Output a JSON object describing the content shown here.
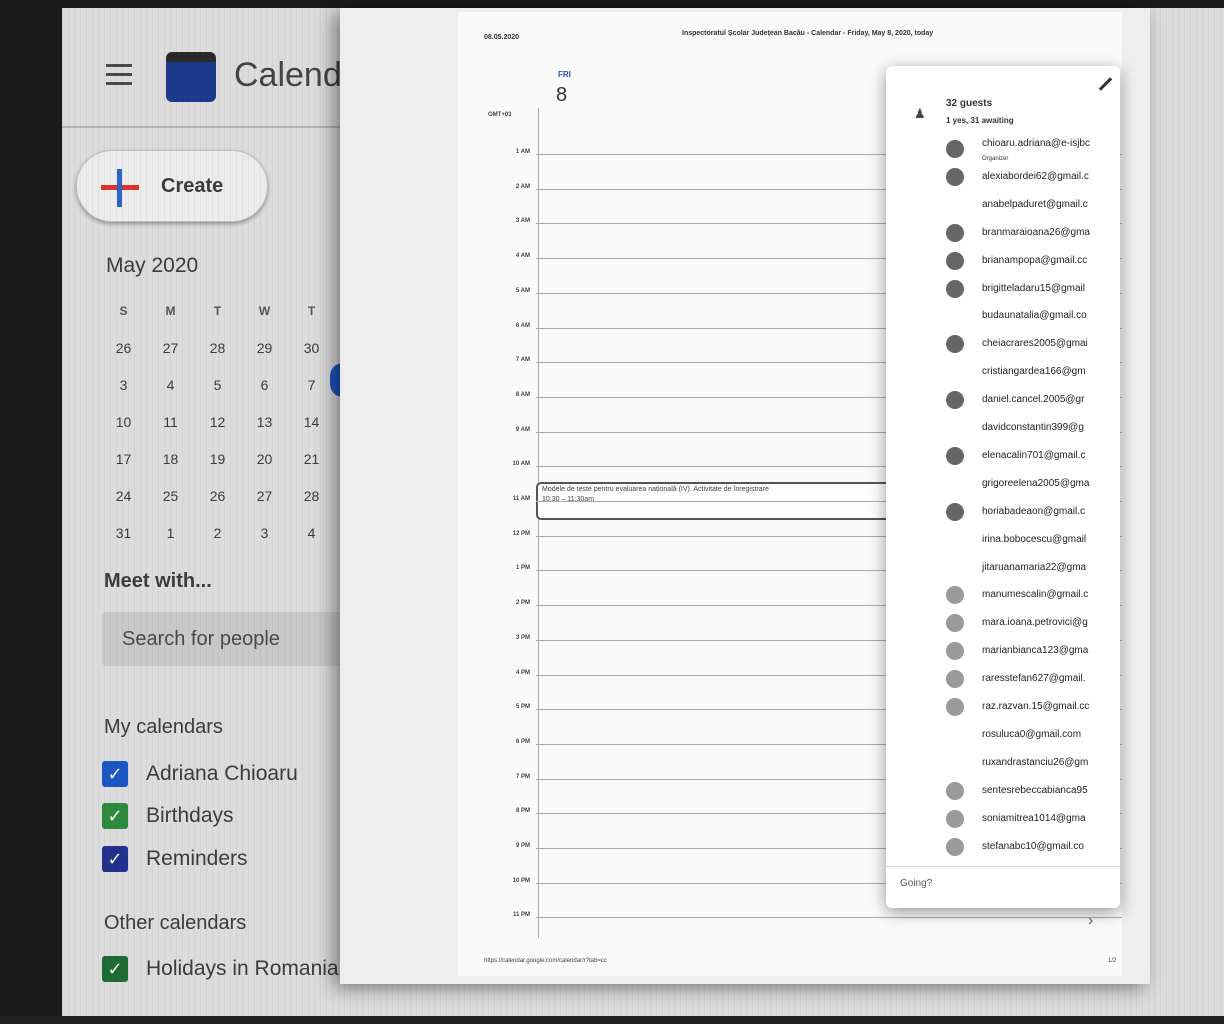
{
  "sidebar": {
    "app_title": "Calend",
    "create_label": "Create",
    "month_title": "May 2020",
    "weekday_headers": [
      "S",
      "M",
      "T",
      "W",
      "T"
    ],
    "weeks": [
      [
        "26",
        "27",
        "28",
        "29",
        "30"
      ],
      [
        "3",
        "4",
        "5",
        "6",
        "7"
      ],
      [
        "10",
        "11",
        "12",
        "13",
        "14"
      ],
      [
        "17",
        "18",
        "19",
        "20",
        "21"
      ],
      [
        "24",
        "25",
        "26",
        "27",
        "28"
      ],
      [
        "31",
        "1",
        "2",
        "3",
        "4"
      ]
    ],
    "meet_title": "Meet with...",
    "search_placeholder": "Search for people",
    "my_calendars_title": "My calendars",
    "my_calendars": [
      {
        "label": "Adriana Chioaru",
        "color": "#1a56c4",
        "checked": true
      },
      {
        "label": "Birthdays",
        "color": "#2e8b3e",
        "checked": true
      },
      {
        "label": "Reminders",
        "color": "#23318f",
        "checked": true
      }
    ],
    "other_calendars_title": "Other calendars",
    "other_calendars": [
      {
        "label": "Holidays in Romania",
        "color": "#1f6b34",
        "checked": true
      }
    ],
    "today_color": "#1a56c4"
  },
  "print_preview": {
    "date": "08.05.2020",
    "header": "Inspectoratul Școlar Județean Bacău - Calendar - Friday, May 8, 2020, today",
    "day_abbrev": "FRI",
    "day_number": "8",
    "timezone": "GMT+03",
    "hours": [
      "1 AM",
      "2 AM",
      "3 AM",
      "4 AM",
      "5 AM",
      "6 AM",
      "7 AM",
      "8 AM",
      "9 AM",
      "10 AM",
      "11 AM",
      "12 PM",
      "1 PM",
      "2 PM",
      "3 PM",
      "4 PM",
      "5 PM",
      "6 PM",
      "7 PM",
      "8 PM",
      "9 PM",
      "10 PM",
      "11 PM"
    ],
    "event": {
      "title": "Modele de teste pentru evaluarea națională (IV). Activitate de înregistrare",
      "time": "10:30 – 11:30am"
    },
    "url": "https://calendar.google.com/calendar/r?tab=cc",
    "page": "1/2"
  },
  "popup": {
    "guest_count": "32 guests",
    "guest_status": "1 yes, 31 awaiting",
    "organizer_role": "Organizer",
    "going_label": "Going?",
    "guests": [
      {
        "email": "chioaru.adriana@e-isjbc",
        "avatar": "dark"
      },
      {
        "email": "alexiabordei62@gmail.c",
        "avatar": "dark"
      },
      {
        "email": "anabelpaduret@gmail.c",
        "avatar": "none"
      },
      {
        "email": "branmaraioana26@gma",
        "avatar": "dark"
      },
      {
        "email": "brianampopa@gmail.cc",
        "avatar": "dark"
      },
      {
        "email": "brigitteladaru15@gmail",
        "avatar": "dark"
      },
      {
        "email": "budaunatalia@gmail.co",
        "avatar": "none"
      },
      {
        "email": "cheiacrares2005@gmai",
        "avatar": "dark"
      },
      {
        "email": "cristiangardea166@gm",
        "avatar": "none"
      },
      {
        "email": "daniel.cancel.2005@gr",
        "avatar": "dark"
      },
      {
        "email": "davidconstantin399@g",
        "avatar": "none"
      },
      {
        "email": "elenacalin701@gmail.c",
        "avatar": "dark"
      },
      {
        "email": "grigoreelena2005@gma",
        "avatar": "none"
      },
      {
        "email": "horiabadeaon@gmail.c",
        "avatar": "dark"
      },
      {
        "email": "irina.bobocescu@gmail",
        "avatar": "none"
      },
      {
        "email": "jitaruanamaria22@gma",
        "avatar": "none"
      },
      {
        "email": "manumescalin@gmail.c",
        "avatar": "light"
      },
      {
        "email": "mara.ioana.petrovici@g",
        "avatar": "light"
      },
      {
        "email": "marianbianca123@gma",
        "avatar": "light"
      },
      {
        "email": "raresstefan627@gmail.",
        "avatar": "light"
      },
      {
        "email": "raz.razvan.15@gmail.cc",
        "avatar": "light"
      },
      {
        "email": "rosuluca0@gmail.com",
        "avatar": "none"
      },
      {
        "email": "ruxandrastanciu26@gm",
        "avatar": "none"
      },
      {
        "email": "sentesrebeccabianca95",
        "avatar": "light"
      },
      {
        "email": "soniamitrea1014@gma",
        "avatar": "light"
      },
      {
        "email": "stefanabc10@gmail.co",
        "avatar": "light"
      }
    ]
  }
}
